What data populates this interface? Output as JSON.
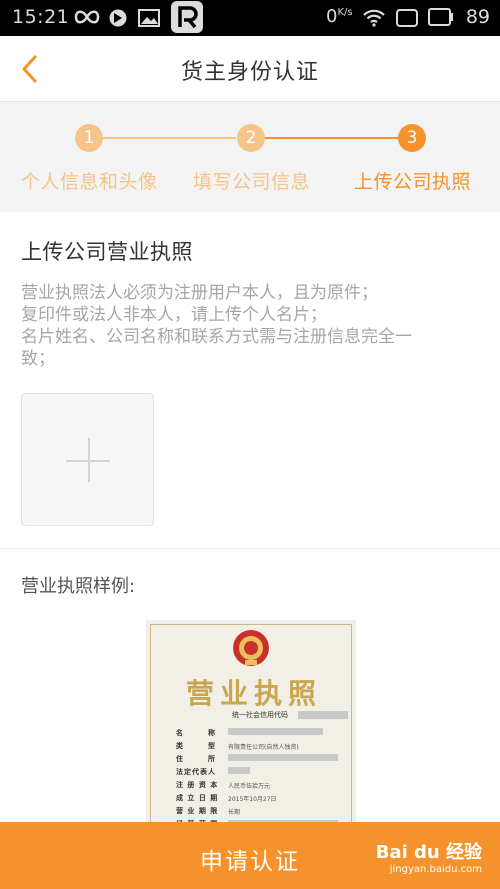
{
  "status_bar": {
    "time": "15:21",
    "network": "0",
    "network_unit": "K/s",
    "battery": "89"
  },
  "header": {
    "title": "货主身份认证"
  },
  "steps": [
    {
      "number": "1",
      "label": "个人信息和头像",
      "state": "done"
    },
    {
      "number": "2",
      "label": "填写公司信息",
      "state": "done"
    },
    {
      "number": "3",
      "label": "上传公司执照",
      "state": "active"
    }
  ],
  "colors": {
    "accent": "#f5922b",
    "step_done": "#f6c488",
    "step_active": "#f5922b",
    "steps_bg": "#f4f3f3"
  },
  "upload": {
    "title": "上传公司营业执照",
    "notes": [
      "营业执照法人必须为注册用户本人，且为原件；",
      "复印件或法人非本人，请上传个人名片；",
      "名片姓名、公司名称和联系方式需与注册信息完全一",
      "致；"
    ]
  },
  "sample": {
    "title": "营业执照样例:",
    "license_title": "营业执照",
    "code_label": "统一社会信用代码",
    "fields": [
      {
        "label": "名　　　称",
        "value": ""
      },
      {
        "label": "类　　　型",
        "value": "有限责任公司(自然人独资)"
      },
      {
        "label": "住　　　所",
        "value": ""
      },
      {
        "label": "法定代表人",
        "value": ""
      },
      {
        "label": "注 册 资 本",
        "value": "人民币伍拾万元"
      },
      {
        "label": "成 立 日 期",
        "value": "2015年10月27日"
      },
      {
        "label": "营 业 期 限",
        "value": "长期"
      },
      {
        "label": "经 营 范 围",
        "value": ""
      }
    ]
  },
  "footer": {
    "submit_label": "申请认证"
  },
  "watermark": {
    "brand": "Bai du 经验",
    "url": "jingyan.baidu.com"
  }
}
